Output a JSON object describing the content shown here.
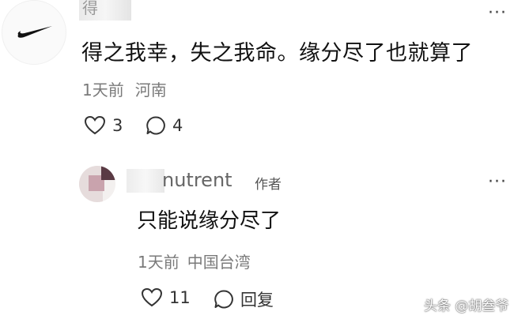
{
  "comment1": {
    "username_partial": "得",
    "text": "得之我幸，失之我命。缘分尽了也就算了",
    "time": "1天前",
    "location": "河南",
    "likes": "3",
    "comments": "4",
    "more": "···"
  },
  "reply": {
    "username_visible": "nutrent",
    "author_tag": "作者",
    "text": "只能说缘分尽了",
    "time": "1天前",
    "location": "中国台湾",
    "likes": "11",
    "reply_label": "回复",
    "more": "···"
  },
  "watermark": "头条 @胡叁爷",
  "icons": [
    "nike-swoosh-logo",
    "heart-icon",
    "comment-icon",
    "more-icon"
  ],
  "colors": {
    "text": "#111111",
    "meta": "#7a7a7a",
    "background": "#ffffff"
  }
}
